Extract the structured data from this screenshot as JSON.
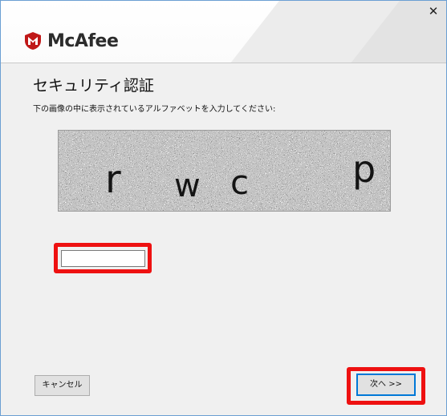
{
  "brand": {
    "name": "McAfee",
    "accent_color": "#c01818"
  },
  "window": {
    "close_glyph": "✕"
  },
  "page": {
    "title": "セキュリティ認証",
    "instruction": "下の画像の中に表示されているアルファベットを入力してください:"
  },
  "captcha": {
    "characters": [
      "r",
      "w",
      "c",
      "p"
    ]
  },
  "input": {
    "value": "",
    "placeholder": ""
  },
  "buttons": {
    "cancel_label": "キャンセル",
    "next_label": "次へ >>"
  },
  "highlight_color": "#ee1111"
}
